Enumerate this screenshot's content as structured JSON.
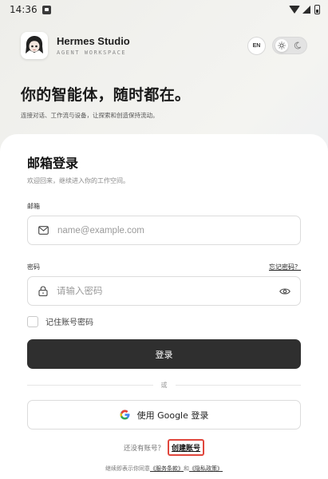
{
  "status_bar": {
    "time": "14:36"
  },
  "brand": {
    "name": "Hermes Studio",
    "subtitle": "AGENT WORKSPACE",
    "lang_button": "EN"
  },
  "hero": {
    "title": "你的智能体，随时都在。",
    "subtitle": "连接对话、工作流与设备，让探索和创造保持流动。"
  },
  "login": {
    "title": "邮箱登录",
    "subtitle": "欢迎回来，继续进入你的工作空间。",
    "email_label": "邮箱",
    "email_placeholder": "name@example.com",
    "email_value": "",
    "password_label": "密码",
    "forgot_link": "忘记密码？",
    "password_placeholder": "请输入密码",
    "password_value": "",
    "remember_label": "记住账号密码",
    "remember_checked": false,
    "submit_label": "登录",
    "divider_text": "或",
    "google_label": "使用 Google 登录",
    "signup_prompt": "还没有账号？",
    "signup_link": "创建账号",
    "terms_prefix": "继续即表示你同意",
    "terms_link": "《服务条款》",
    "terms_and": "和",
    "privacy_link": "《隐私政策》"
  },
  "icons": {
    "status": [
      "sim-icon",
      "wifi-icon",
      "signal-icon",
      "battery-icon"
    ],
    "theme": [
      "sun-icon",
      "moon-icon"
    ],
    "fields": [
      "mail-icon",
      "lock-icon",
      "eye-icon"
    ],
    "provider": "google-icon"
  },
  "colors": {
    "primary_button": "#2f2f2f",
    "highlight_border": "#e0463c",
    "card_bg": "#ffffff"
  }
}
